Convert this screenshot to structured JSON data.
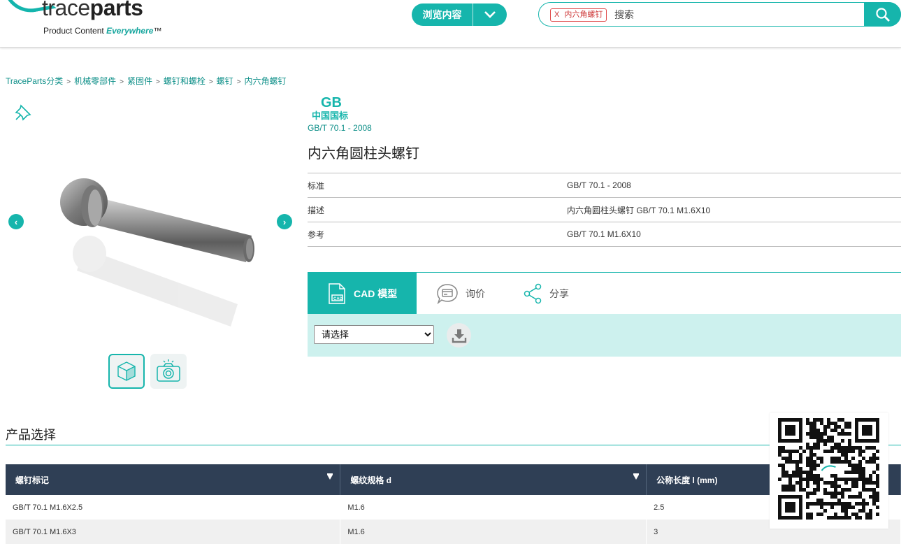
{
  "header": {
    "logo_word_light": "trace",
    "logo_word_bold": "parts",
    "logo_tag_plain": "Product Content ",
    "logo_tag_accent": "Everywhere",
    "logo_tag_tm": "™",
    "browse_label": "浏览内容",
    "search_tag": "内六角螺钉",
    "search_tag_close": "X",
    "search_placeholder": "搜索"
  },
  "breadcrumb": [
    "TraceParts分类",
    "机械零部件",
    "紧固件",
    "螺钉和螺栓",
    "螺钉",
    "内六角螺钉"
  ],
  "breadcrumb_sep": ">",
  "product": {
    "std_logo_big": "GB",
    "std_logo_small": "中国国标",
    "std_code": "GB/T 70.1 - 2008",
    "title": "内六角圆柱头螺钉",
    "info": [
      {
        "key": "标准",
        "value": "GB/T 70.1 - 2008"
      },
      {
        "key": "描述",
        "value": "内六角圆柱头螺钉 GB/T 70.1 M1.6X10"
      },
      {
        "key": "参考",
        "value": "GB/T 70.1 M1.6X10"
      }
    ],
    "nav_prev": "‹",
    "nav_next": "›"
  },
  "tabs": {
    "cad": "CAD 模型",
    "quote": "询价",
    "share": "分享"
  },
  "cad_panel": {
    "selected_format": "请选择"
  },
  "selection": {
    "title": "产品选择",
    "columns": [
      "螺钉标记",
      "螺纹规格 d",
      "公称长度 l (mm)"
    ],
    "rows": [
      [
        "GB/T 70.1 M1.6X2.5",
        "M1.6",
        "2.5"
      ],
      [
        "GB/T 70.1 M1.6X3",
        "M1.6",
        "3"
      ]
    ]
  },
  "colors": {
    "accent": "#16b5ac",
    "table_header": "#2f3f55",
    "panel_bg": "#cdf1ee"
  }
}
